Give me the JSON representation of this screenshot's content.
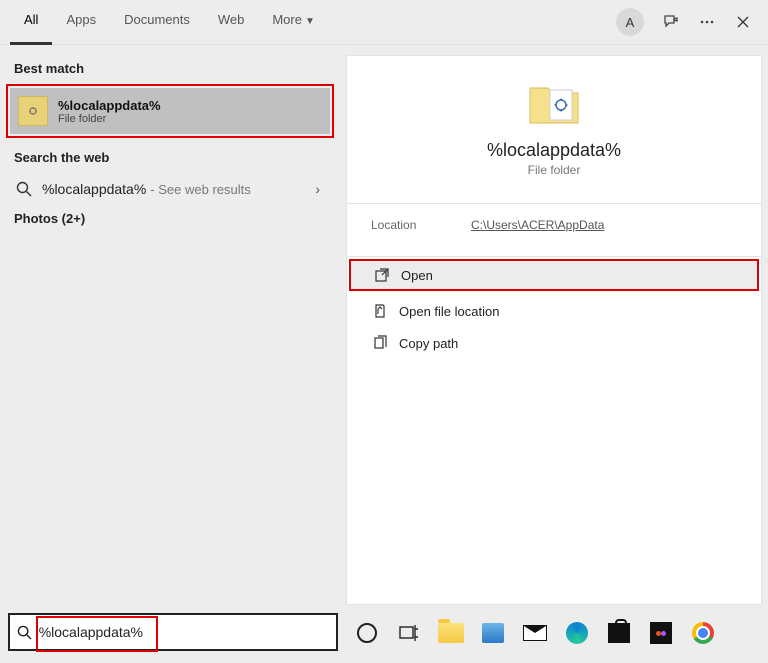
{
  "header": {
    "tabs": [
      "All",
      "Apps",
      "Documents",
      "Web",
      "More"
    ],
    "active_tab": 0,
    "avatar_letter": "A"
  },
  "left": {
    "best_match_label": "Best match",
    "best_match": {
      "title": "%localappdata%",
      "subtitle": "File folder"
    },
    "web_label": "Search the web",
    "web_item": {
      "title": "%localappdata%",
      "suffix": " - See web results"
    },
    "photos_label": "Photos (2+)"
  },
  "right": {
    "preview_title": "%localappdata%",
    "preview_subtitle": "File folder",
    "location_label": "Location",
    "location_value": "C:\\Users\\ACER\\AppData",
    "actions": [
      "Open",
      "Open file location",
      "Copy path"
    ]
  },
  "searchbar": {
    "value": "%localappdata%"
  }
}
